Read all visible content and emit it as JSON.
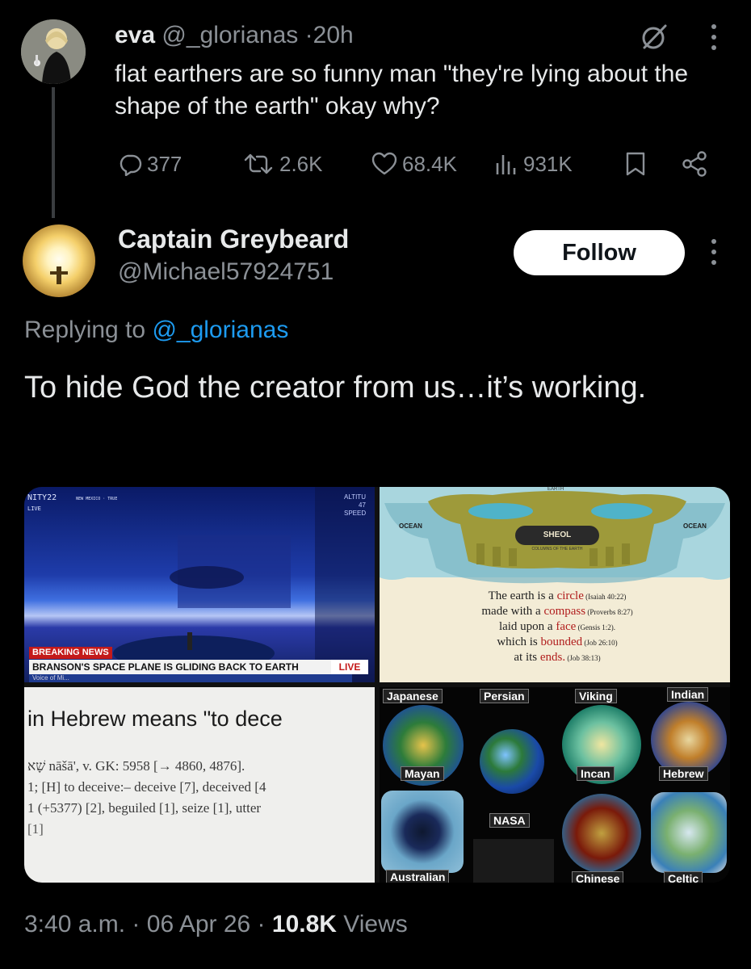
{
  "parent_tweet": {
    "name": "eva",
    "handle": "@_glorianas",
    "separator": "·",
    "time": "20h",
    "text": "flat earthers are so funny man \"they're lying about the shape of the earth\" okay why?",
    "metrics": {
      "replies": "377",
      "reposts": "2.6K",
      "likes": "68.4K",
      "views": "931K"
    },
    "icons": [
      "grok-icon",
      "more-icon",
      "reply-icon",
      "repost-icon",
      "like-icon",
      "views-icon",
      "bookmark-icon",
      "share-icon"
    ]
  },
  "reply_tweet": {
    "name": "Captain Greybeard",
    "handle": "@Michael57924751",
    "follow_label": "Follow",
    "replying_prefix": "Replying to",
    "replying_to": "@_glorianas",
    "text": "To hide God the creator from us…it’s working.",
    "media": {
      "news": {
        "channel": "NITY22",
        "live_small": "LIVE",
        "ticker_small": "NEW MEXICO · TRUE",
        "altitude": "ALTITU",
        "altitude_val": "47",
        "speed": "SPEED",
        "breaking": "BREAKING NEWS",
        "headline": "BRANSON'S SPACE PLANE IS GLIDING BACK TO EARTH",
        "live_badge": "LIVE",
        "voice": "Voice of Mi..."
      },
      "cosmology": {
        "earth": "EARTH",
        "ocean_left": "OCEAN",
        "ocean_right": "OCEAN",
        "sheol": "SHEOL",
        "columns": "COLUMNS OF THE EARTH",
        "verse_l1_a": "The earth is a ",
        "verse_l1_kw": "circle",
        "verse_l1_ref": " (Isaiah 40:22)",
        "verse_l2_a": "made with a ",
        "verse_l2_kw": "compass",
        "verse_l2_ref": " (Proverbs 8:27)",
        "verse_l3_a": "laid upon a ",
        "verse_l3_kw": "face",
        "verse_l3_ref": " (Gensis 1:2).",
        "verse_l4_a": "which is ",
        "verse_l4_kw": "bounded",
        "verse_l4_ref": " (Job 26:10)",
        "verse_l5_a": "at its ",
        "verse_l5_kw": "ends.",
        "verse_l5_ref": " (Job 38:13)"
      },
      "hebrew": {
        "headline": "in Hebrew means \"to dece",
        "line1": "שָׁא nāšā', v. GK: 5958 [→ 4860, 4876].",
        "line2": "1; [H] to deceive:– deceive [7], deceived [4",
        "line3": "1 (+5377) [2], beguiled [1], seize [1], utter",
        "line4": "[1]"
      },
      "cosmologies": {
        "labels": [
          "Japanese",
          "Persian",
          "Viking",
          "Indian",
          "Mayan",
          "Incan",
          "Hebrew",
          "NASA",
          "Australian",
          "Chinese",
          "Celtic"
        ]
      }
    }
  },
  "footer": {
    "time": "3:40 a.m.",
    "separator": "·",
    "date": "06 Apr 26",
    "views_count": "10.8K",
    "views_label": "Views"
  },
  "colors": {
    "background": "#000000",
    "text": "#e7e9ea",
    "muted": "#8b9096",
    "link": "#1d9bf0",
    "follow_bg": "#ffffff"
  }
}
